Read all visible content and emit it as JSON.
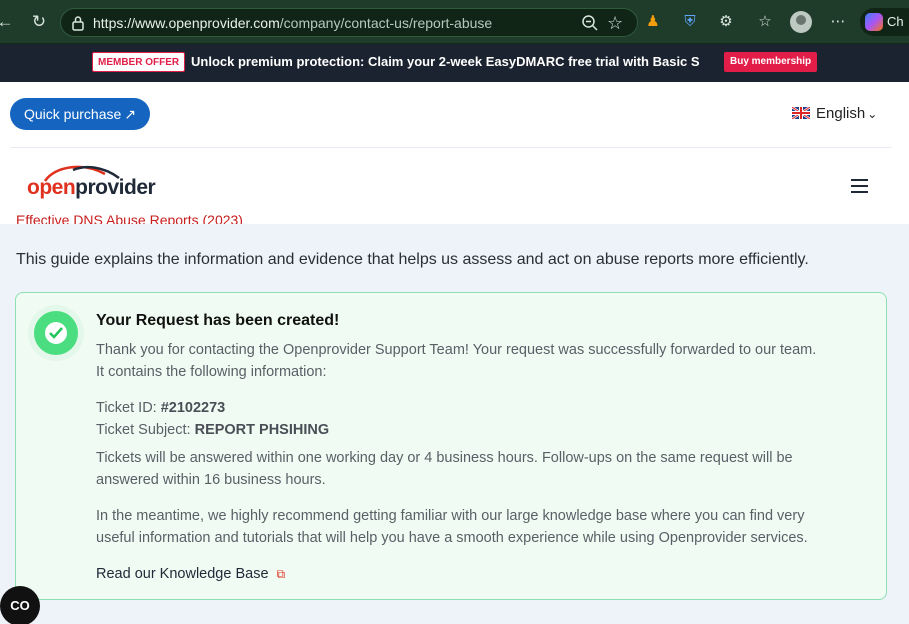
{
  "browser": {
    "url_base": "https://www.openprovider.com",
    "url_path": "/company/contact-us/report-abuse",
    "copilot_label": "Ch"
  },
  "promo": {
    "badge": "MEMBER OFFER",
    "message": "Unlock premium protection: Claim your 2-week EasyDMARC free trial with Basic S",
    "cta": "Buy membership"
  },
  "header": {
    "quick_purchase": "Quick purchase",
    "quick_arrow": "↗",
    "language": "English",
    "logo_open": "open",
    "logo_provider": "provider"
  },
  "content": {
    "cut_link": "Effective DNS Abuse Reports (2023)",
    "guide_text": "This guide explains the information and evidence that helps us assess and act on abuse reports more efficiently."
  },
  "card": {
    "title": "Your Request has been created!",
    "intro_line1": "Thank you for contacting the Openprovider Support Team! Your request was successfully forwarded to our team.",
    "intro_line2": "It contains the following information:",
    "ticket_id_label": "Ticket ID: ",
    "ticket_id": "#2102273",
    "ticket_subject_label": "Ticket Subject: ",
    "ticket_subject": "REPORT PHSIHING",
    "sla_line1": "Tickets will be answered within one working day or 4 business hours. Follow-ups on the same request will be",
    "sla_line2": "answered within 16 business hours.",
    "kb_line1": "In the meantime, we highly recommend getting familiar with our large knowledge base where you can find very",
    "kb_line2": "useful information and tutorials that will help you have a smooth experience while using Openprovider services.",
    "kb_link": "Read our Knowledge Base"
  },
  "cookie_label": "CO",
  "colors": {
    "brand_red": "#e0301e",
    "button_blue": "#1565c0",
    "success_green": "#4ade80"
  }
}
